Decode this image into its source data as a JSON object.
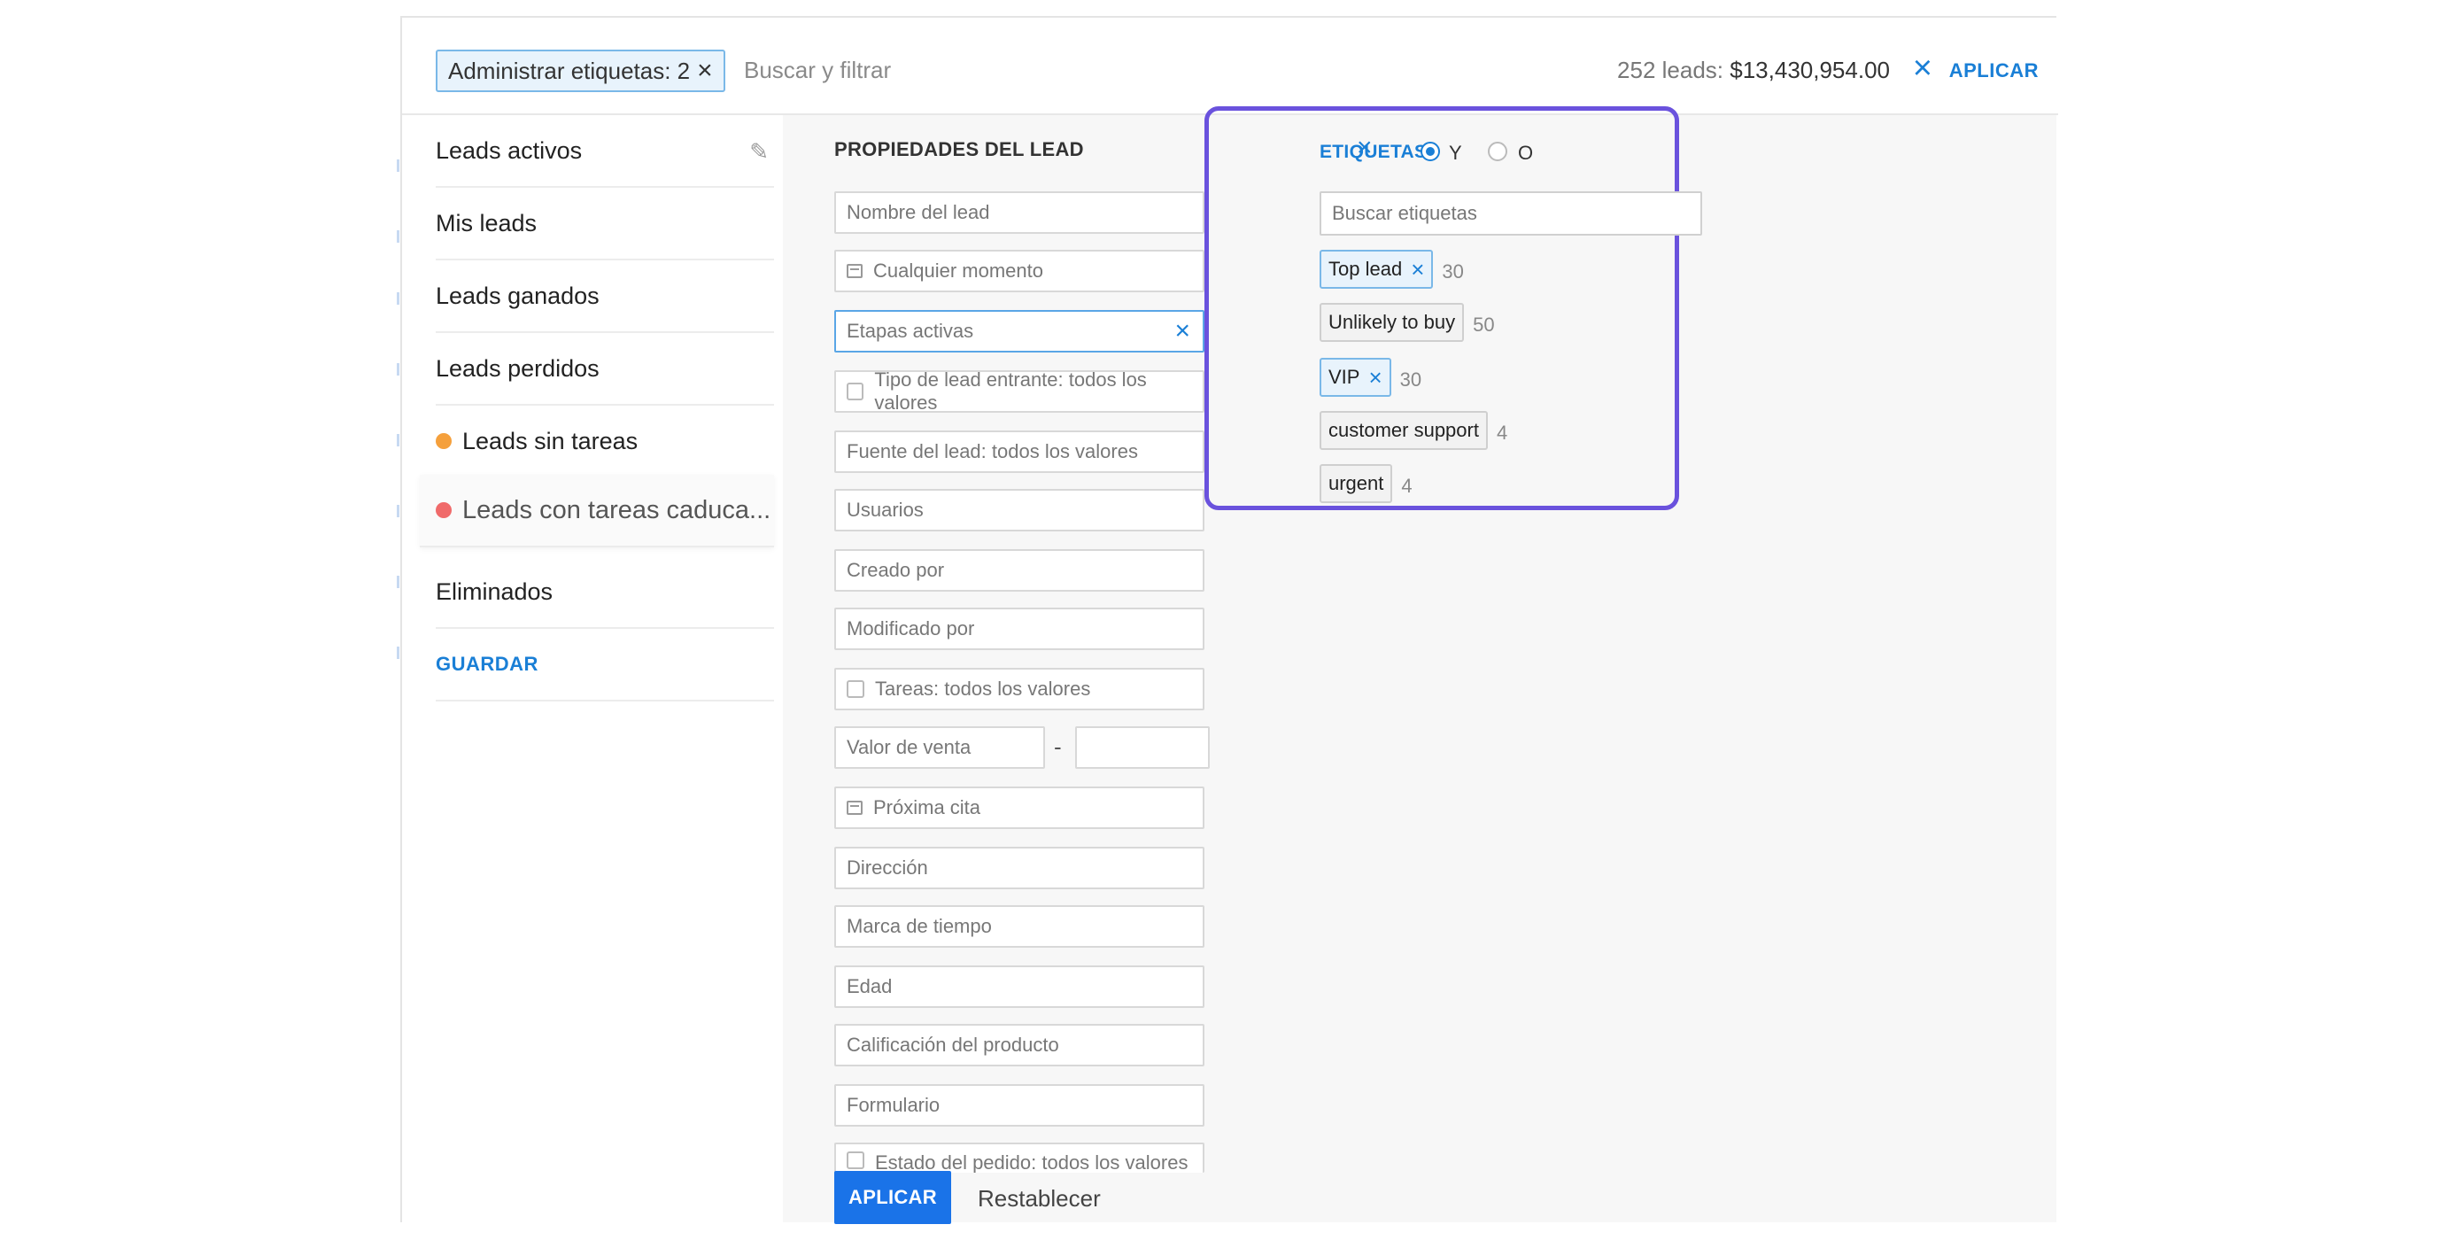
{
  "topbar": {
    "filter_chip": "Administrar etiquetas: 2",
    "search_placeholder": "Buscar y filtrar",
    "leads_count": "252 leads:",
    "leads_value": "$13,430,954.00",
    "apply_label": "APLICAR"
  },
  "sidebar": {
    "items": [
      {
        "label": "Leads activos"
      },
      {
        "label": "Mis leads"
      },
      {
        "label": "Leads ganados"
      },
      {
        "label": "Leads perdidos"
      },
      {
        "label": "Leads sin tareas",
        "dot_color": "#f5a03c"
      },
      {
        "label": "Leads con tareas caduca...",
        "dot_color": "#f06a6a"
      },
      {
        "label": "Eliminados"
      }
    ],
    "save_label": "GUARDAR"
  },
  "properties": {
    "title": "PROPIEDADES DEL LEAD",
    "fields": [
      "Nombre del lead",
      "Cualquier momento",
      "Etapas activas",
      "Tipo de lead entrante: todos los valores",
      "Fuente del lead: todos los valores",
      "Usuarios",
      "Creado por",
      "Modificado por",
      "Tareas: todos los valores",
      "Valor de venta",
      "Próxima cita",
      "Dirección",
      "Marca de tiempo",
      "Edad",
      "Calificación del producto",
      "Formulario",
      "Estado del pedido: todos los valores"
    ],
    "range_separator": "-",
    "apply_label": "APLICAR",
    "reset_label": "Restablecer"
  },
  "tags": {
    "title": "ETIQUETAS",
    "logic_and": "Y",
    "logic_or": "O",
    "logic_selected": "Y",
    "search_placeholder": "Buscar etiquetas",
    "items": [
      {
        "name": "Top lead",
        "count": "30",
        "selected": true
      },
      {
        "name": "Unlikely to buy",
        "count": "50",
        "selected": false
      },
      {
        "name": "VIP",
        "count": "30",
        "selected": true
      },
      {
        "name": "customer support",
        "count": "4",
        "selected": false
      },
      {
        "name": "urgent",
        "count": "4",
        "selected": false
      }
    ],
    "highlight_color": "#6a52dd"
  },
  "colors": {
    "accent": "#1a7fd6",
    "primary_button": "#1a73e8"
  }
}
